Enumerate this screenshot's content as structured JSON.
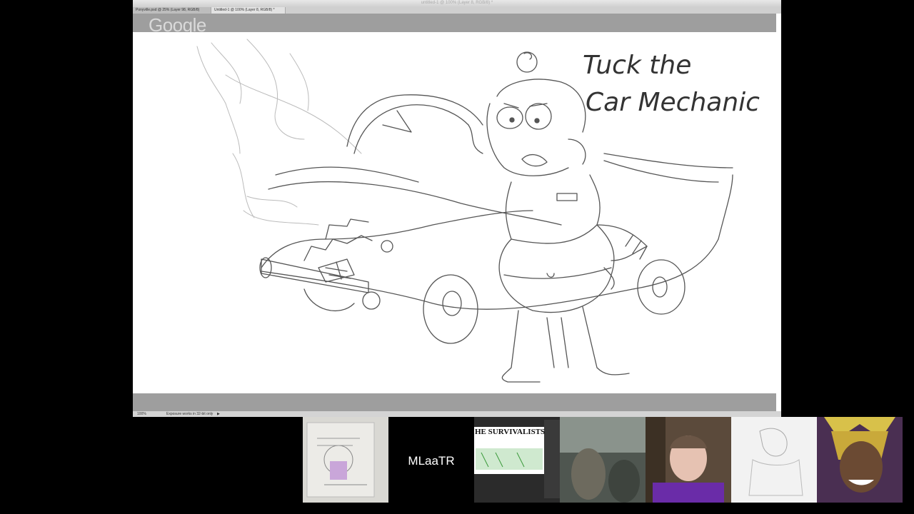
{
  "app": {
    "window_title": "untitled-1 @ 100% (Layer 8, RGB/8) *",
    "tabs": [
      {
        "label": "Ponyville.psd @ 25% (Layer 98, RGB/8)"
      },
      {
        "label": "Untitled-1 @ 100% (Layer 8, RGB/8) *"
      }
    ],
    "status": {
      "zoom": "100%",
      "info": "Exposure works in 32-bit only"
    }
  },
  "overlay": {
    "logo_text": "Google"
  },
  "sketch": {
    "title_line1": "Tuck the",
    "title_line2": "Car Mechanic"
  },
  "participants": [
    {
      "name": "",
      "type": "video"
    },
    {
      "name": "MLaaTR",
      "type": "name-tile"
    },
    {
      "name": "",
      "type": "video",
      "caption": "HE SURVIVALISTS"
    },
    {
      "name": "",
      "type": "video"
    },
    {
      "name": "",
      "type": "video"
    },
    {
      "name": "",
      "type": "video"
    },
    {
      "name": "",
      "type": "video"
    }
  ],
  "colors": {
    "background": "#000000",
    "canvas": "#ffffff",
    "ui_gray": "#9e9e9e"
  }
}
